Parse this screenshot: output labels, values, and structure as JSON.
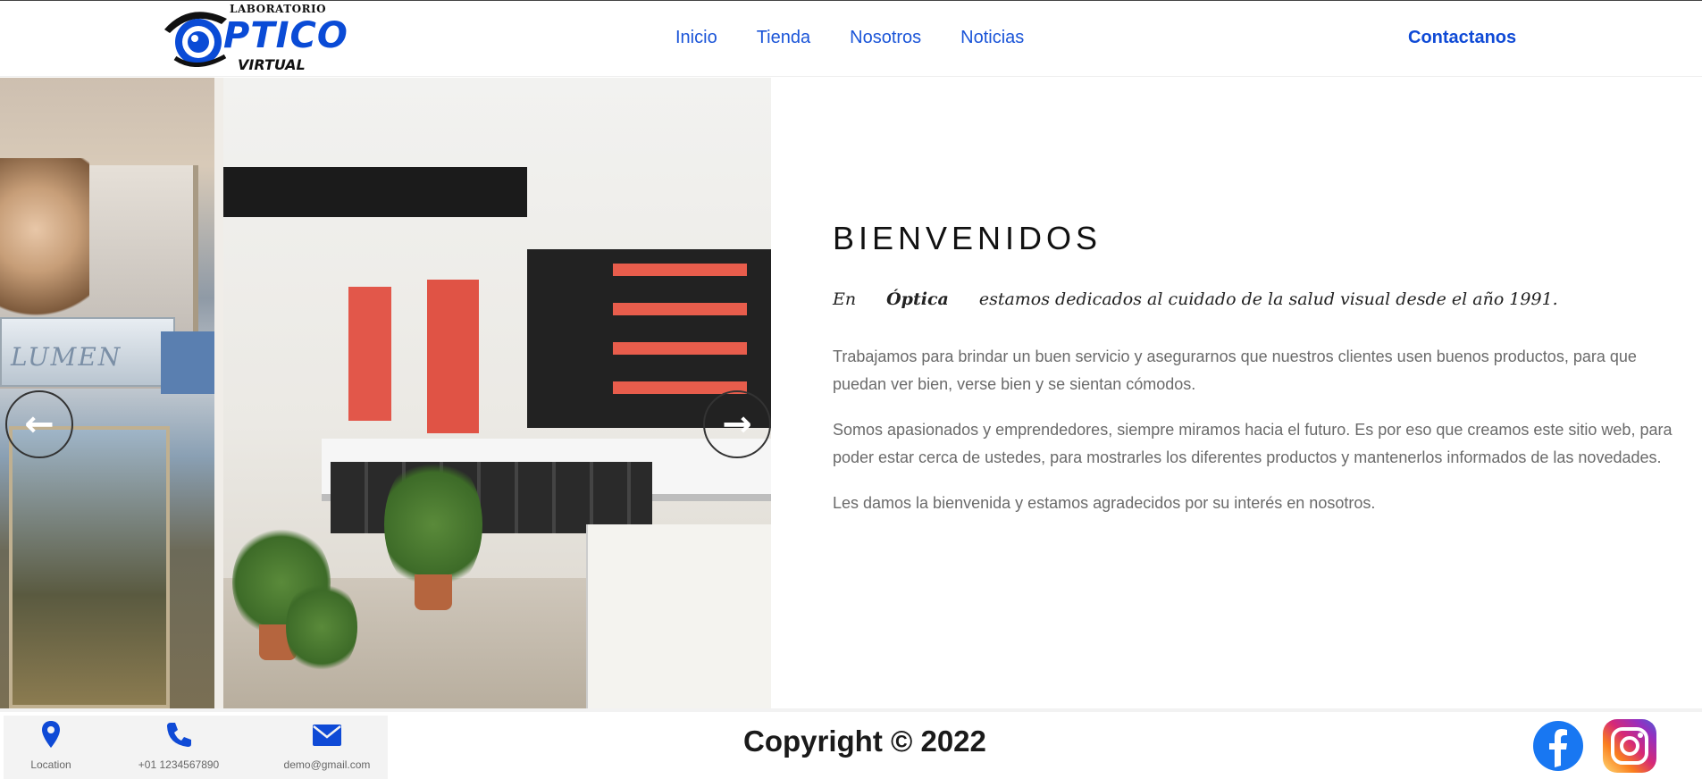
{
  "header": {
    "logo": {
      "top": "LABORATORIO",
      "main": "PTICO",
      "bottom": "VIRTUAL"
    },
    "nav": [
      {
        "label": "Inicio"
      },
      {
        "label": "Tienda"
      },
      {
        "label": "Nosotros"
      },
      {
        "label": "Noticias"
      }
    ],
    "contact_label": "Contactanos"
  },
  "carousel": {
    "prev_icon": "arrow-left-icon",
    "next_icon": "arrow-right-icon",
    "store_sign": "LUMEN"
  },
  "welcome": {
    "title": "BIENVENIDOS",
    "lead_prefix": "En",
    "lead_brand": "Óptica",
    "lead_suffix": "estamos dedicados al cuidado de la salud visual desde el año 1991.",
    "paragraphs": [
      "Trabajamos para brindar un buen servicio y asegurarnos que nuestros clientes usen buenos productos, para que puedan ver bien, verse bien y se sientan cómodos.",
      "Somos apasionados y emprendedores, siempre miramos hacia el futuro. Es por eso que creamos este sitio web, para poder estar cerca de ustedes, para mostrarles los diferentes productos y mantenerlos informados de las novedades.",
      "Les damos la bienvenida y estamos agradecidos por su interés en nosotros."
    ]
  },
  "footer": {
    "contacts": [
      {
        "icon": "location-pin-icon",
        "label": "Location"
      },
      {
        "icon": "phone-icon",
        "label": "+01 1234567890"
      },
      {
        "icon": "envelope-icon",
        "label": "demo@gmail.com"
      }
    ],
    "copyright": "Copyright © 2022",
    "social": [
      {
        "icon": "facebook-icon"
      },
      {
        "icon": "instagram-icon"
      }
    ]
  },
  "colors": {
    "brand_blue": "#0a4bd6",
    "nav_blue": "#1b55d8",
    "body_text": "#6a6a6a"
  }
}
